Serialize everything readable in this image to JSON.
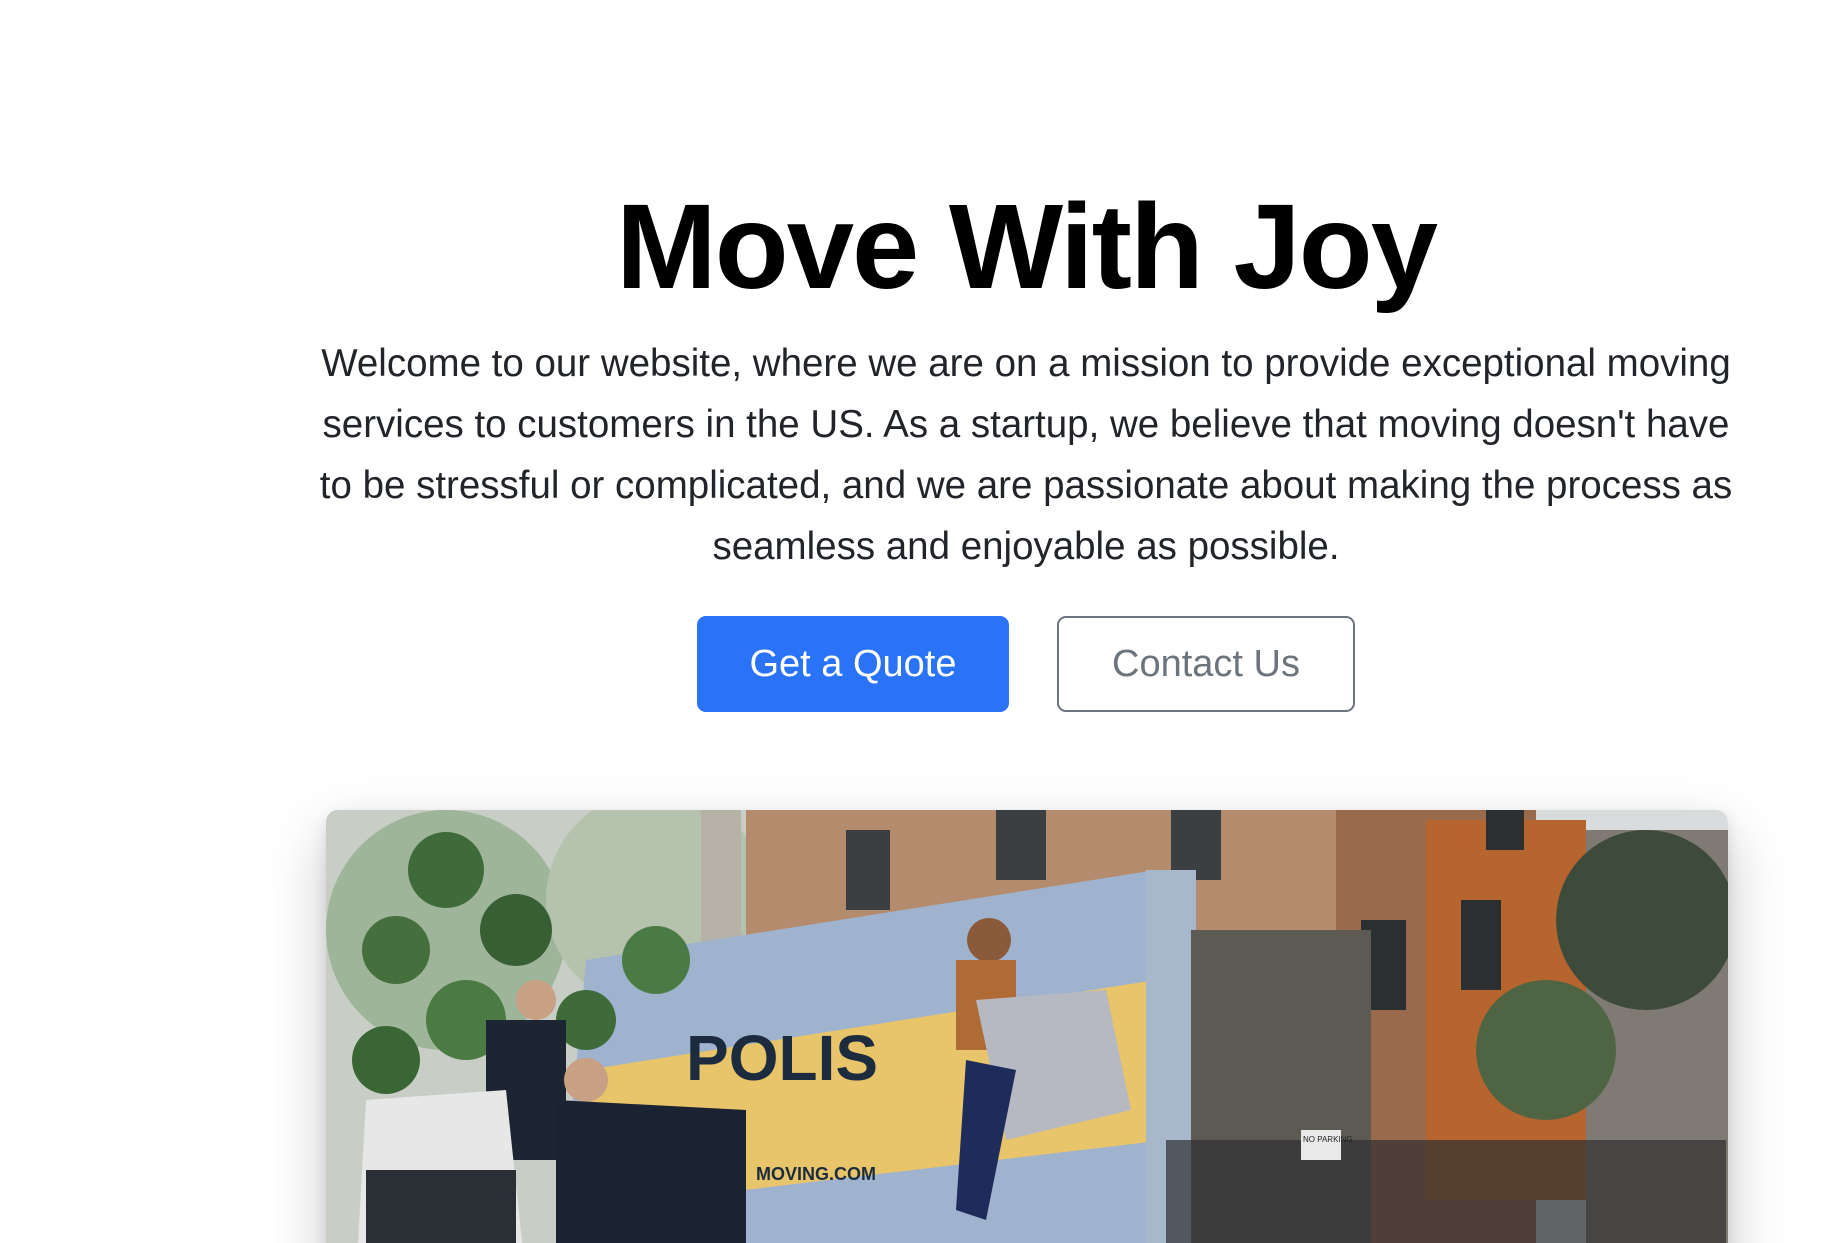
{
  "hero": {
    "title": "Move With Joy",
    "lead": "Welcome to our website, where we are on a mission to provide exceptional moving services to customers in the US. As a startup, we believe that moving doesn't have to be stressful or complicated, and we are passionate about making the process as seamless and enjoyable as possible.",
    "primary_button_label": "Get a Quote",
    "secondary_button_label": "Contact Us",
    "primary_color": "#2a73f6",
    "secondary_color": "#6c757d"
  },
  "image": {
    "alt_role": "moving-truck-photo",
    "truck_text_brand": "POLIS",
    "truck_text_site": "MOVING.COM",
    "sign_text": "NO PARKING"
  }
}
